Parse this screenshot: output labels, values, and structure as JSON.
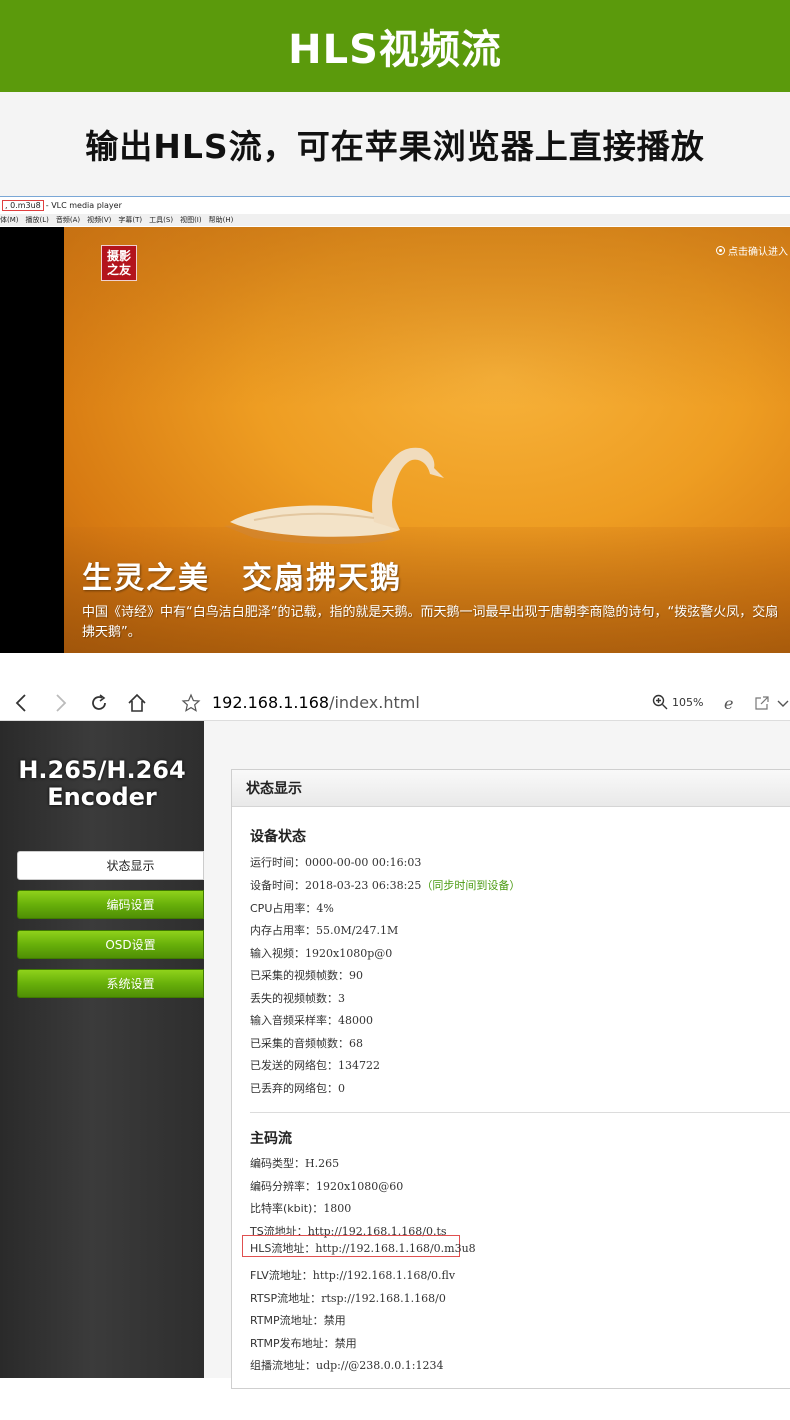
{
  "banner": {
    "title": "HLS视频流"
  },
  "subtitle": "输出HLS流，可在苹果浏览器上直接播放",
  "vlc": {
    "title_file": ", 0.m3u8",
    "title_app": "- VLC media player",
    "menu": [
      "体(M)",
      "播放(L)",
      "音频(A)",
      "视频(V)",
      "字幕(T)",
      "工具(S)",
      "视图(I)",
      "帮助(H)"
    ],
    "logo_line1": "摄影",
    "logo_line2": "之友",
    "enter_hint": "点击确认进入",
    "caption": "生灵之美　交扇拂天鹅",
    "description": "中国《诗经》中有“白鸟洁白肥泽”的记载，指的就是天鹅。而天鹅一词最早出现于唐朝李商隐的诗句，“拨弦警火凤，交扇拂天鹅”。"
  },
  "browser": {
    "address_host": "192.168.1.168",
    "address_path": "/index.html",
    "zoom": "105%",
    "icons": [
      "back-icon",
      "forward-icon",
      "refresh-icon",
      "home-icon",
      "star-icon",
      "zoom-icon",
      "ie-icon",
      "share-icon",
      "chevron-down-icon"
    ]
  },
  "sidebar": {
    "logo_line1": "H.265/H.264",
    "logo_line2": "Encoder",
    "items": [
      {
        "label": "状态显示",
        "active": true
      },
      {
        "label": "编码设置",
        "active": false
      },
      {
        "label": "OSD设置",
        "active": false
      },
      {
        "label": "系统设置",
        "active": false
      }
    ]
  },
  "panel": {
    "header": "状态显示",
    "device_title": "设备状态",
    "device_rows": [
      {
        "label": "运行时间：",
        "value": "0000-00-00 00:16:03"
      },
      {
        "label": "设备时间：",
        "value": "2018-03-23 06:38:25",
        "link": "（同步时间到设备）"
      },
      {
        "label": "CPU占用率：",
        "value": "4%"
      },
      {
        "label": "内存占用率：",
        "value": "55.0M/247.1M"
      },
      {
        "label": "输入视频：",
        "value": "1920x1080p@0"
      },
      {
        "label": "已采集的视频帧数：",
        "value": "90"
      },
      {
        "label": "丢失的视频帧数：",
        "value": "3"
      },
      {
        "label": "输入音频采样率：",
        "value": "48000"
      },
      {
        "label": "已采集的音频帧数：",
        "value": "68"
      },
      {
        "label": "已发送的网络包：",
        "value": "134722"
      },
      {
        "label": "已丢弃的网络包：",
        "value": "0"
      }
    ],
    "stream_title": "主码流",
    "stream_rows": [
      {
        "label": "编码类型：",
        "value": "H.265"
      },
      {
        "label": "编码分辨率：",
        "value": "1920x1080@60"
      },
      {
        "label": "比特率(kbit)：",
        "value": "1800"
      },
      {
        "label": "TS流地址：",
        "value": "http://192.168.1.168/0.ts"
      },
      {
        "label": "HLS流地址：",
        "value": "http://192.168.1.168/0.m3u8"
      },
      {
        "label": "FLV流地址：",
        "value": "http://192.168.1.168/0.flv"
      },
      {
        "label": "RTSP流地址：",
        "value": "rtsp://192.168.1.168/0"
      },
      {
        "label": "RTMP流地址：",
        "value": "禁用"
      },
      {
        "label": "RTMP发布地址：",
        "value": "禁用"
      },
      {
        "label": "组播流地址：",
        "value": "udp://@238.0.0.1:1234"
      }
    ]
  }
}
